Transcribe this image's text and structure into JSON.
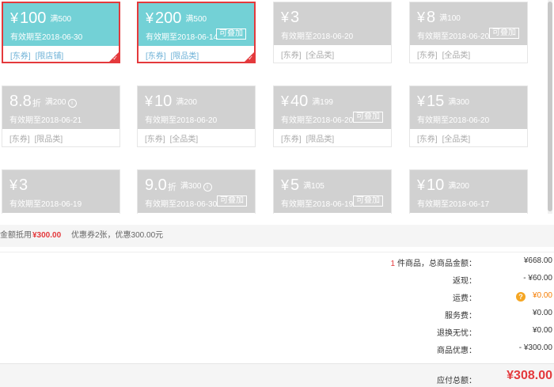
{
  "coupons": [
    {
      "amount": "100",
      "quota": "满500",
      "expire": "有效期至2018-06-30",
      "tags": [
        "[东券]",
        "[限店铺]"
      ],
      "stack": "",
      "selected": true
    },
    {
      "amount": "200",
      "quota": "满500",
      "expire": "有效期至2018-06-14",
      "tags": [
        "[东券]",
        "[限品类]"
      ],
      "stack": "可叠加",
      "selected": true
    },
    {
      "amount": "3",
      "quota": "",
      "expire": "有效期至2018-06-20",
      "tags": [
        "[东券]",
        "[全品类]"
      ],
      "stack": "",
      "selected": false
    },
    {
      "amount": "8",
      "quota": "满100",
      "expire": "有效期至2018-06-20",
      "tags": [
        "[东券]",
        "[全品类]"
      ],
      "stack": "可叠加",
      "selected": false
    },
    {
      "amount": "8.8",
      "unit": "折",
      "quota": "满200",
      "info": true,
      "expire": "有效期至2018-06-21",
      "tags": [
        "[东券]",
        "[限品类]"
      ],
      "stack": "",
      "selected": false
    },
    {
      "amount": "10",
      "quota": "满200",
      "expire": "有效期至2018-06-20",
      "tags": [
        "[东券]",
        "[全品类]"
      ],
      "stack": "",
      "selected": false
    },
    {
      "amount": "40",
      "quota": "满199",
      "expire": "有效期至2018-06-20",
      "tags": [
        "[东券]",
        "[限品类]"
      ],
      "stack": "可叠加",
      "selected": false
    },
    {
      "amount": "15",
      "quota": "满300",
      "expire": "有效期至2018-06-20",
      "tags": [
        "[东券]",
        "[全品类]"
      ],
      "stack": "",
      "selected": false
    },
    {
      "amount": "3",
      "quota": "",
      "expire": "有效期至2018-06-19",
      "tags": [],
      "stack": "",
      "selected": false
    },
    {
      "amount": "9.0",
      "unit": "折",
      "quota": "满300",
      "info": true,
      "expire": "有效期至2018-06-30",
      "tags": [],
      "stack": "可叠加",
      "selected": false
    },
    {
      "amount": "5",
      "quota": "满105",
      "expire": "有效期至2018-06-19",
      "tags": [],
      "stack": "可叠加",
      "selected": false
    },
    {
      "amount": "10",
      "quota": "满200",
      "expire": "有效期至2018-06-17",
      "tags": [],
      "stack": "",
      "selected": false
    }
  ],
  "currency": "¥",
  "summary": {
    "label": "金额抵用",
    "value": "¥300.00",
    "detail": "优惠券2张，优惠300.00元"
  },
  "totals": {
    "items_count": "1",
    "items_label": "件商品，总商品金额：",
    "items_value": "¥668.00",
    "cashback_label": "返现：",
    "cashback_value": "- ¥60.00",
    "shipping_label": "运费：",
    "shipping_value": "¥0.00",
    "service_label": "服务费：",
    "service_value": "¥0.00",
    "return_label": "退换无忧：",
    "return_value": "¥0.00",
    "discount_label": "商品优惠：",
    "discount_value": "- ¥300.00",
    "payable_label": "应付总额：",
    "payable_value": "¥308.00",
    "help_icon": "?"
  },
  "colors": {
    "selected_bg": "#73d1d6",
    "inactive_bg": "#d1d1d1",
    "accent_red": "#e4393c",
    "shipping_orange": "#f57c00"
  }
}
